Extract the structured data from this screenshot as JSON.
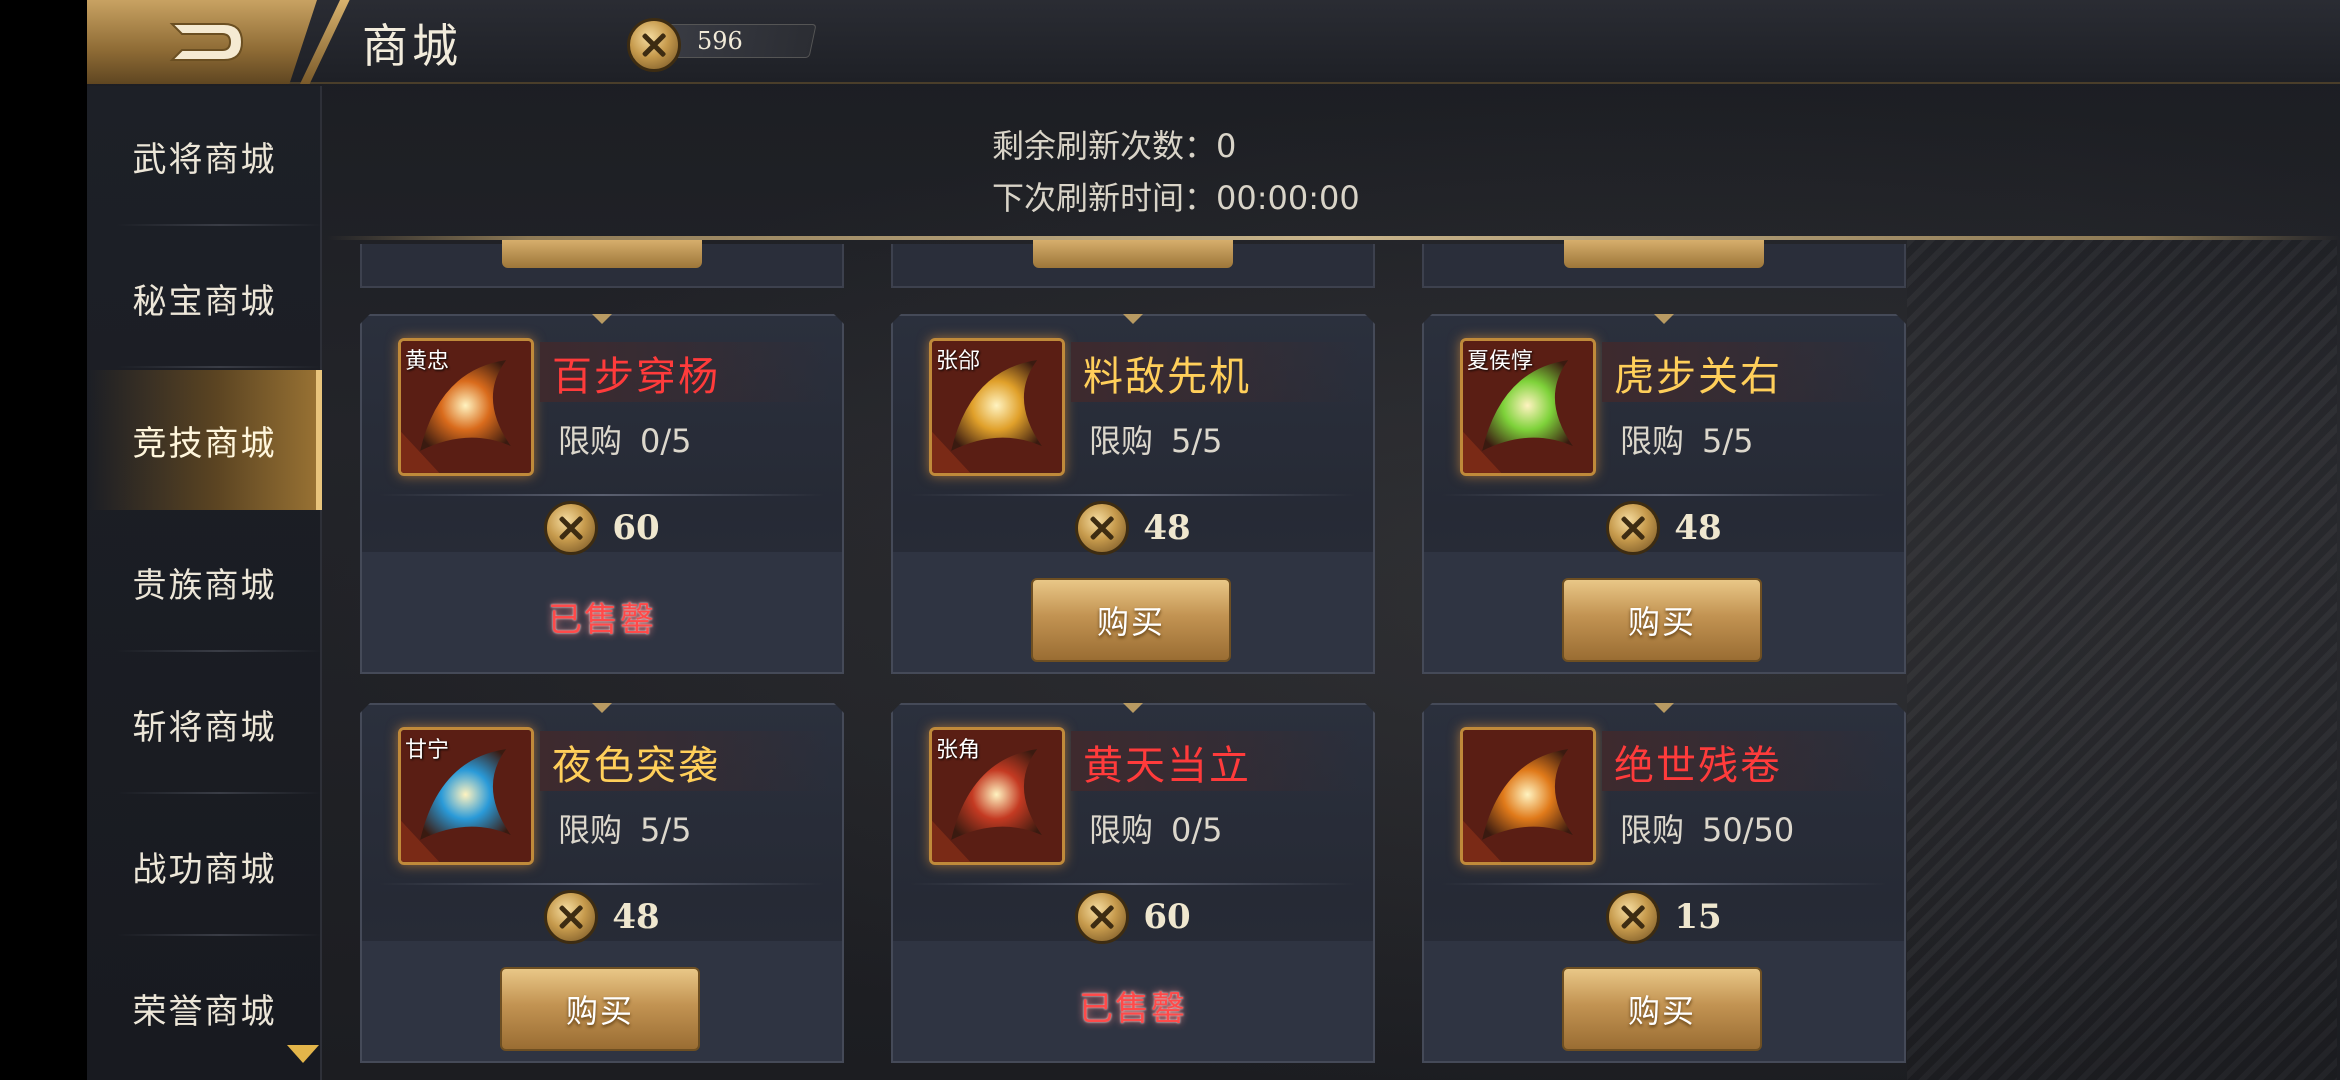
{
  "header": {
    "title": "商城",
    "currency_value": "596"
  },
  "sidebar": {
    "items": [
      {
        "label": "武将商城",
        "active": false
      },
      {
        "label": "秘宝商城",
        "active": false
      },
      {
        "label": "竞技商城",
        "active": true
      },
      {
        "label": "贵族商城",
        "active": false
      },
      {
        "label": "斩将商城",
        "active": false
      },
      {
        "label": "战功商城",
        "active": false
      },
      {
        "label": "荣誉商城",
        "active": false
      }
    ]
  },
  "refresh": {
    "remaining_label": "剩余刷新次数：",
    "remaining_value": "0",
    "next_label": "下次刷新时间：",
    "next_value": "00:00:00"
  },
  "cards": [
    {
      "hero": "黄忠",
      "name": "百步穿杨",
      "name_color": "#ff3b3b",
      "limit_label": "限购",
      "limit": "0/5",
      "price": "60",
      "action": "已售罄",
      "sold_out": true,
      "icon_color": "#d96b1c"
    },
    {
      "hero": "张郃",
      "name": "料敌先机",
      "name_color": "#ffcf5a",
      "limit_label": "限购",
      "limit": "5/5",
      "price": "48",
      "action": "购买",
      "sold_out": false,
      "icon_color": "#e0a02a"
    },
    {
      "hero": "夏侯惇",
      "name": "虎步关右",
      "name_color": "#ffcf5a",
      "limit_label": "限购",
      "limit": "5/5",
      "price": "48",
      "action": "购买",
      "sold_out": false,
      "icon_color": "#7ed23a"
    },
    {
      "hero": "甘宁",
      "name": "夜色突袭",
      "name_color": "#ffcf5a",
      "limit_label": "限购",
      "limit": "5/5",
      "price": "48",
      "action": "购买",
      "sold_out": false,
      "icon_color": "#2a9ad8"
    },
    {
      "hero": "张角",
      "name": "黄天当立",
      "name_color": "#ff3b3b",
      "limit_label": "限购",
      "limit": "0/5",
      "price": "60",
      "action": "已售罄",
      "sold_out": true,
      "icon_color": "#c43a22"
    },
    {
      "hero": "",
      "name": "绝世残卷",
      "name_color": "#ff3b3b",
      "limit_label": "限购",
      "limit": "50/50",
      "price": "15",
      "action": "购买",
      "sold_out": false,
      "icon_color": "#e07a1a"
    }
  ],
  "icons": {
    "back": "back-arrow-icon",
    "currency": "crossed-swords-coin-icon",
    "scroll_down": "chevron-down-icon",
    "volume": "speaker-icon",
    "settings": "gear-icon"
  }
}
